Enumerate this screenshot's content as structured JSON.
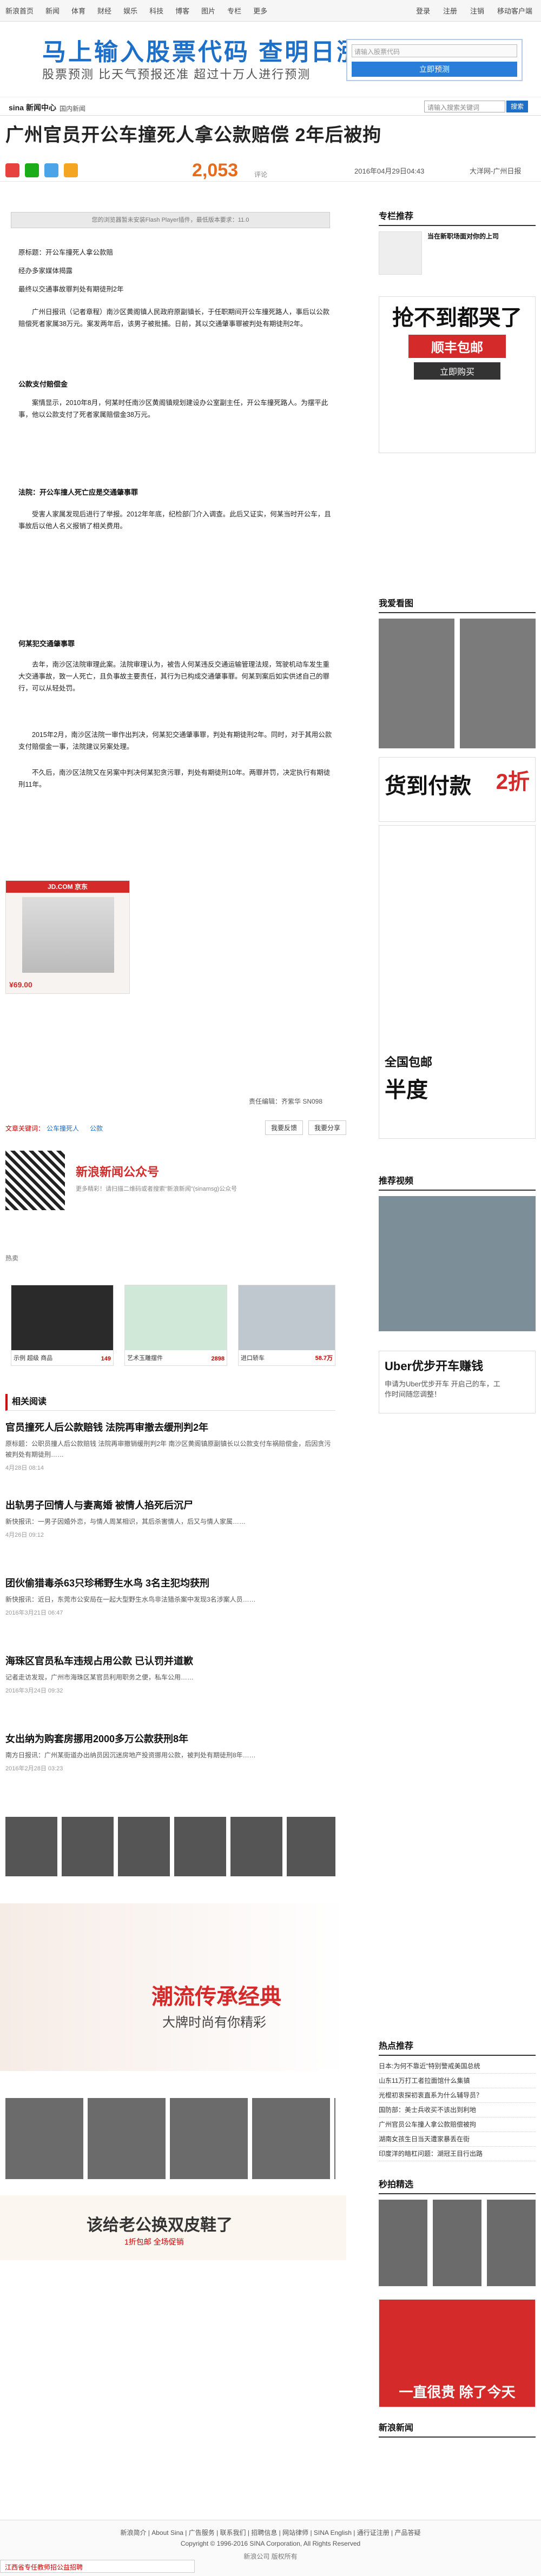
{
  "topbar": {
    "left": [
      "新浪首页",
      "新闻",
      "体育",
      "财经",
      "娱乐",
      "科技",
      "博客",
      "图片",
      "专栏",
      "更多"
    ],
    "right": [
      "登录",
      "注册",
      "注销",
      "移动客户端"
    ]
  },
  "banner": {
    "title": "马上输入股票代码  查明日涨跌",
    "subtitle": "股票预测 比天气预报还准  超过十万人进行预测",
    "input_placeholder": "请输入股票代码",
    "button": "立即预测"
  },
  "channel": {
    "logo": "sina",
    "logo_sub": "新闻中心",
    "crumb": "国内新闻",
    "search_placeholder": "请输入搜索关键词",
    "search_button": "搜索"
  },
  "article": {
    "title": "广州官员开公车撞死人拿公款赔偿 2年后被拘",
    "count": "2,053",
    "count_label": "评论",
    "date": "2016年04月29日04:43",
    "source": "大洋网-广州日报",
    "flash_notice": "您的浏览器暂未安装Flash Player插件，最低版本要求：11.0",
    "paragraphs": [
      "原标题：开公车撞死人拿公款赔",
      "经办多家媒体揭露",
      "最终以交通事故罪判处有期徒刑2年",
      "广州日报讯（记者章程）南沙区黄阁镇人民政府原副镇长，于任职期间开公车撞死路人，事后以公款赔偿死者家属38万元。案发两年后，该男子被批捕。日前，其以交通肇事罪被判处有期徒刑2年。",
      "公款支付赔偿金",
      "案情显示，2010年8月，何某时任南沙区黄阁镇规划建设办公室副主任，开公车撞死路人。为摆平此事，他以公款支付了死者家属赔偿金38万元。",
      "法院：开公车撞人死亡应是交通肇事罪",
      "受害人家属发现后进行了举报。2012年年底，纪检部门介入调查。此后又证实，何某当时开公车，且事故后以他人名义报销了相关费用。",
      "何某犯交通肇事罪",
      "去年，南沙区法院审理此案。法院审理认为，被告人何某违反交通运输管理法规，驾驶机动车发生重大交通事故，致一人死亡，且负事故主要责任，其行为已构成交通肇事罪。何某到案后如实供述自己的罪行，可以从轻处罚。",
      "2015年2月，南沙区法院一审作出判决，何某犯交通肇事罪，判处有期徒刑2年。同时，对于其用公款支付赔偿金一事，法院建议另案处理。",
      "不久后，南沙区法院又在另案中判决何某犯贪污罪，判处有期徒刑10年。两罪并罚，决定执行有期徒刑11年。"
    ],
    "editor": "责任编辑：齐紫华 SN098"
  },
  "jd_ad": {
    "brand": "JD.COM 京东",
    "price": "¥69.00"
  },
  "right_ads": {
    "belt_title": "抢不到都哭了",
    "belt_sub": "顺丰包邮",
    "belt_cta": "立即购买",
    "cod_title": "货到付款",
    "cod_sub": "2折",
    "shoe_title": "全国包邮",
    "shoe_sub": "半度",
    "uber_title": "Uber优步开车赚钱",
    "uber_sub": "申请为Uber优步开车 开启己的车，工作时间随您调整！"
  },
  "right": {
    "col_title": "专栏推荐",
    "col_item": "当在新职场面对你的上司",
    "watch_title": "我爱看图",
    "video_title": "推荐视频",
    "hot_title": "热点推荐",
    "hot_items": [
      "日本:为何不靠近\"特别警戒美国总统",
      "山东11万打工者拉面馆什么集镇",
      "光棍初衷探初衷直系为什么辅导员？",
      "国防部：美士兵收买不该出到利地",
      "广州官员公车撞人拿公款赔偿被拘",
      "湖南女孩生日当天遭家暴丢在街",
      "印度洋的暗杠问题：湖冠王目行出路"
    ],
    "pic_title": "秒拍精选",
    "bottom_ad": "一直很贵 除了今天",
    "new_title": "新浪新闻"
  },
  "share": {
    "label": "文章关键词：",
    "keywords": [
      "公车撞死人",
      "公款"
    ],
    "btn1": "我要反馈",
    "btn2": "我要分享"
  },
  "wechat": {
    "title": "新浪新闻公众号",
    "desc": "更多精彩！请扫描二维码或者搜索\"新浪新闻\"(sinamsg)公众号"
  },
  "shop": {
    "label": "热卖",
    "items": [
      {
        "name": "示例 超级 商品",
        "price": "149"
      },
      {
        "name": "艺术玉雕摆件",
        "price": "2898"
      },
      {
        "name": "进口轿车",
        "price": "58.7万"
      }
    ]
  },
  "related": {
    "title": "相关阅读",
    "items": [
      {
        "h": "官员撞死人后公款赔钱 法院再审撤去缓刑判2年",
        "d": "原标题：公职员撞人后公款赔钱 法院再审撤销缓刑判2年 南沙区黄阁镇原副镇长以公款支付车祸赔偿金，后因贪污被判处有期徒刑……",
        "m": "4月28日 08:14"
      },
      {
        "h": "出轨男子回情人与妻离婚 被情人掐死后沉尸",
        "d": "新快报讯：一男子因婚外恋，与情人周某相识，其后杀害情人，后又与情人家属……",
        "m": "4月26日 09:12"
      },
      {
        "h": "团伙偷猎毒杀63只珍稀野生水鸟 3名主犯均获刑",
        "d": "新快报讯：近日，东莞市公安局在一起大型野生水鸟非法猎杀案中发现3名涉案人员……",
        "m": "2016年3月21日 06:47"
      },
      {
        "h": "海珠区官员私车违规占用公款 已认罚并道歉",
        "d": "记者走访发现，广州市海珠区某官员利用职务之便，私车公用……",
        "m": "2016年3月24日 09:32"
      },
      {
        "h": "女出纳为购套房挪用2000多万公款获刑8年",
        "d": "南方日报讯：广州某街道办出纳员因沉迷房地产投资挪用公款，被判处有期徒刑8年……",
        "m": "2016年2月28日 03:23"
      }
    ]
  },
  "strip_ads": {
    "fashion_title": "潮流传承经典",
    "fashion_sub": "大牌时尚有你精彩",
    "shoes_title": "该给老公换双皮鞋了",
    "shoes_sub": "1折包邮 全场促销"
  },
  "footer": {
    "links": "新浪简介 | About Sina | 广告服务 | 联系我们 | 招聘信息 | 网站律师 | SINA English | 通行证注册 | 产品答疑",
    "copyright": "Copyright © 1996-2016 SINA Corporation, All Rights Reserved",
    "corp": "新浪公司 版权所有",
    "bottom_ad": "江西省专任教师招公益招聘"
  }
}
